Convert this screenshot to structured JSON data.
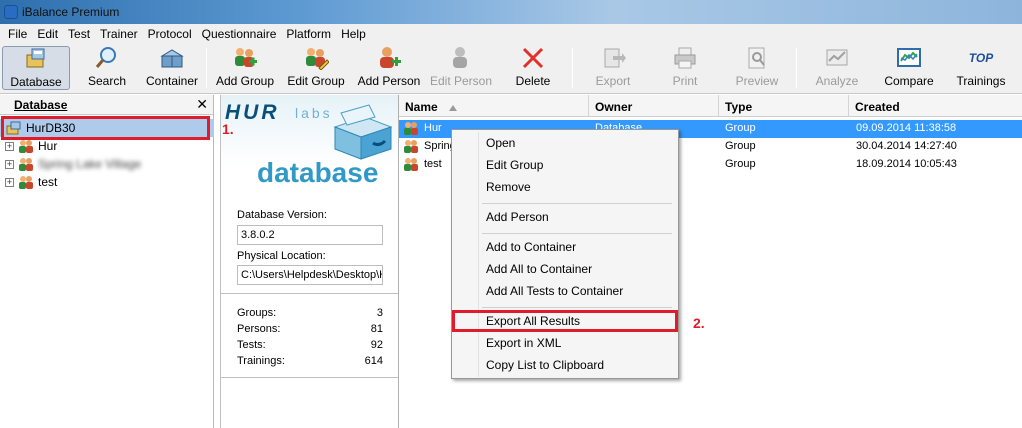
{
  "window": {
    "title": "iBalance Premium"
  },
  "menu": [
    "File",
    "Edit",
    "Test",
    "Trainer",
    "Protocol",
    "Questionnaire",
    "Platform",
    "Help"
  ],
  "toolbar": {
    "database": "Database",
    "search": "Search",
    "container": "Container",
    "add_group": "Add Group",
    "edit_group": "Edit Group",
    "add_person": "Add Person",
    "edit_person": "Edit Person",
    "delete": "Delete",
    "export": "Export",
    "print": "Print",
    "preview": "Preview",
    "analyze": "Analyze",
    "compare": "Compare",
    "trainings": "Trainings",
    "trainings_icon_text": "TOP"
  },
  "left_panel": {
    "title": "Database",
    "close": "✕",
    "tree": [
      {
        "label": "HurDB30"
      },
      {
        "label": "Hur"
      },
      {
        "label": "Spring Lake Village"
      },
      {
        "label": "test"
      }
    ]
  },
  "info": {
    "logo_hur": "HUR",
    "logo_labs": "labs",
    "logo_database": "database",
    "version_label": "Database Version:",
    "version_value": "3.8.0.2",
    "location_label": "Physical Location:",
    "location_value": "C:\\Users\\Helpdesk\\Desktop\\HurDB30",
    "stats": [
      {
        "label": "Groups:",
        "value": "3"
      },
      {
        "label": "Persons:",
        "value": "81"
      },
      {
        "label": "Tests:",
        "value": "92"
      },
      {
        "label": "Trainings:",
        "value": "614"
      }
    ]
  },
  "list": {
    "headers": {
      "name": "Name",
      "owner": "Owner",
      "type": "Type",
      "created": "Created"
    },
    "rows": [
      {
        "name": "Hur",
        "owner": "Database",
        "type": "Group",
        "created": "09.09.2014  11:38:58"
      },
      {
        "name": "Spring",
        "owner": "",
        "type": "Group",
        "created": "30.04.2014  14:27:40"
      },
      {
        "name": "test",
        "owner": "",
        "type": "Group",
        "created": "18.09.2014  10:05:43"
      }
    ]
  },
  "context_menu": {
    "items": [
      "Open",
      "Edit Group",
      "Remove",
      "Add Person",
      "Add to Container",
      "Add All to Container",
      "Add All Tests to Container",
      "Export All Results",
      "Export in XML",
      "Copy List to Clipboard"
    ]
  },
  "annotations": {
    "step1": "1.",
    "step2": "2."
  },
  "colors": {
    "highlight": "#e01b2a",
    "selection": "#3399ff",
    "logo_blue": "#3199c8"
  }
}
